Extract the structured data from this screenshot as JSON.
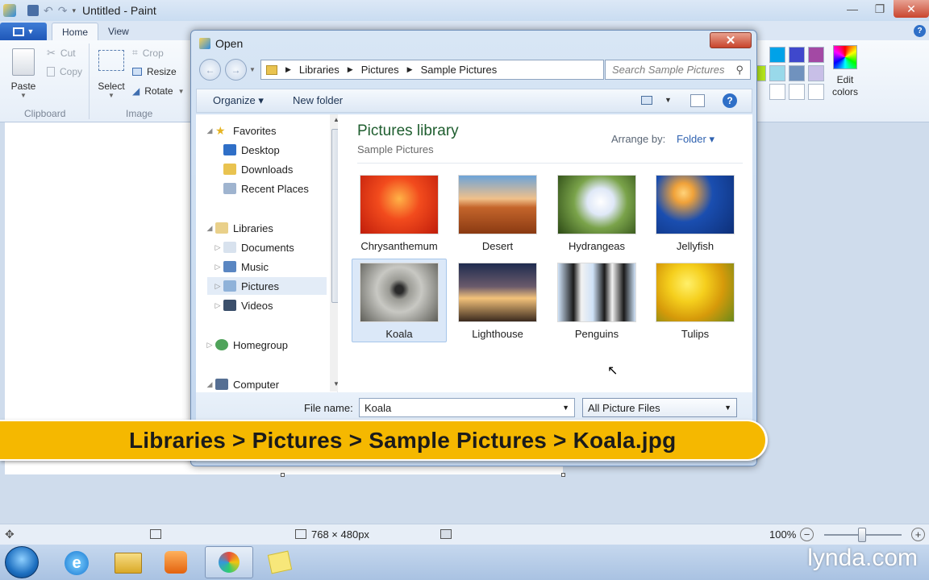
{
  "paint": {
    "title": "Untitled - Paint",
    "tabs": {
      "home": "Home",
      "view": "View"
    },
    "clipboard": {
      "paste": "Paste",
      "cut": "Cut",
      "copy": "Copy",
      "group": "Clipboard"
    },
    "image": {
      "select": "Select",
      "crop": "Crop",
      "resize": "Resize",
      "rotate": "Rotate",
      "group": "Image"
    },
    "colors": {
      "edit": "Edit colors",
      "palette": [
        "#00a2e8",
        "#3f48cc",
        "#a349a4",
        "#b5e61d",
        "#99d9ea",
        "#7092be",
        "#c8bfe7",
        "#ffffff",
        "#ffffff",
        "#ffffff",
        "#ffffff"
      ]
    },
    "status": {
      "dimensions": "768 × 480px",
      "zoom": "100%",
      "zoom_level": 1.0
    }
  },
  "dialog": {
    "title": "Open",
    "close_glyph": "✕",
    "breadcrumb": [
      "Libraries",
      "Pictures",
      "Sample Pictures"
    ],
    "search_placeholder": "Search Sample Pictures",
    "toolbar": {
      "organize": "Organize ▾",
      "new_folder": "New folder"
    },
    "nav": {
      "favorites": "Favorites",
      "desktop": "Desktop",
      "downloads": "Downloads",
      "recent": "Recent Places",
      "libraries": "Libraries",
      "documents": "Documents",
      "music": "Music",
      "pictures": "Pictures",
      "videos": "Videos",
      "homegroup": "Homegroup",
      "computer": "Computer"
    },
    "library_title": "Pictures library",
    "library_subtitle": "Sample Pictures",
    "arrange_label": "Arrange by:",
    "arrange_value": "Folder ▾",
    "files": [
      {
        "name": "Chrysanthemum",
        "colors": [
          "#f24b1d",
          "#c01d0b"
        ]
      },
      {
        "name": "Desert",
        "colors": [
          "#e19a55",
          "#8a3a12"
        ]
      },
      {
        "name": "Hydrangeas",
        "colors": [
          "#eef3e3",
          "#3f6b1f"
        ]
      },
      {
        "name": "Jellyfish",
        "colors": [
          "#f0a23a",
          "#0d2f78"
        ]
      },
      {
        "name": "Koala",
        "colors": [
          "#c8c8c3",
          "#5e5e58"
        ]
      },
      {
        "name": "Lighthouse",
        "colors": [
          "#f3c27a",
          "#1f2c4f"
        ]
      },
      {
        "name": "Penguins",
        "colors": [
          "#cfe2f7",
          "#1a1a1a"
        ]
      },
      {
        "name": "Tulips",
        "colors": [
          "#f5cf1d",
          "#9a6a05"
        ]
      }
    ],
    "filename_label": "File name:",
    "filename_value": "Koala",
    "filetype_value": "All Picture Files"
  },
  "banner": {
    "text": "Libraries > Pictures > Sample Pictures > Koala.jpg"
  },
  "watermark": "lynda.com"
}
